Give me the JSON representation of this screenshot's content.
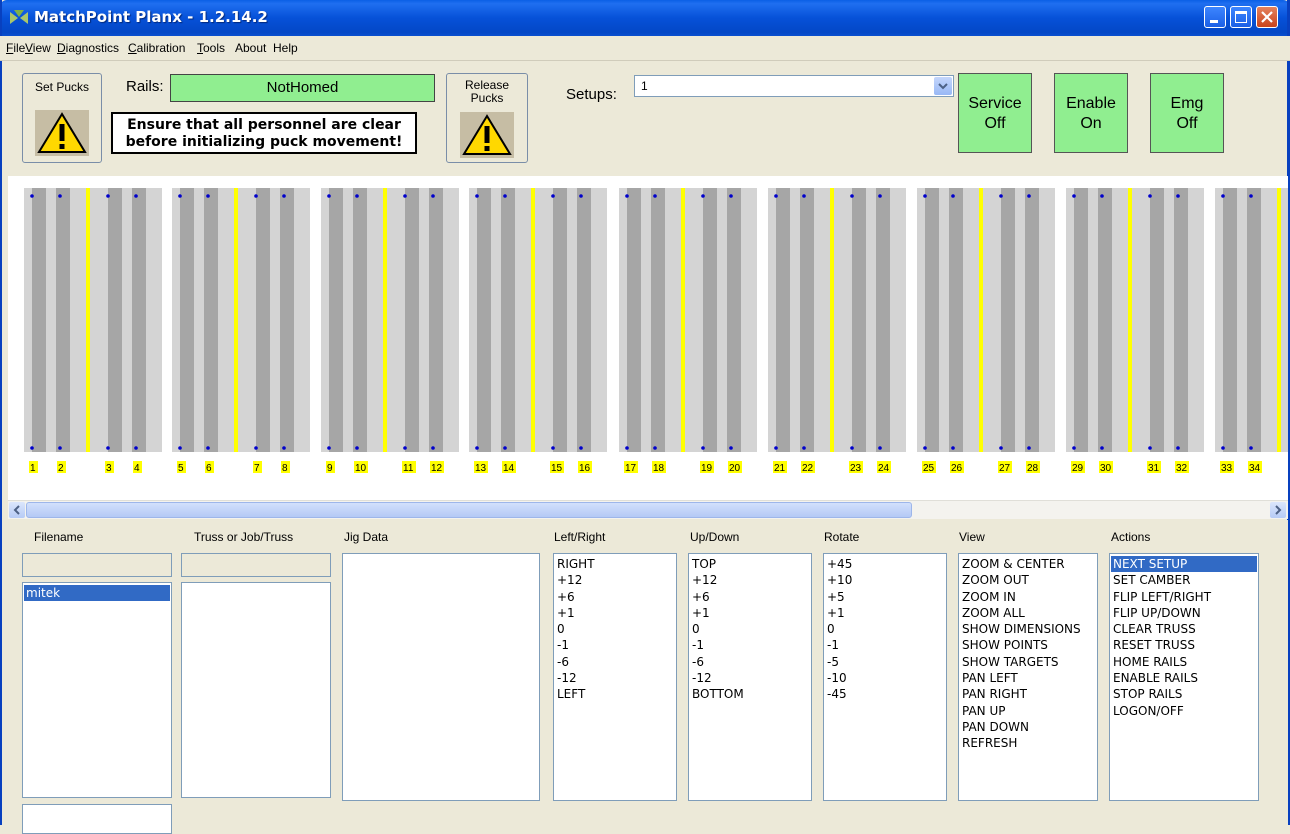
{
  "window": {
    "title": "MatchPoint Planx - 1.2.14.2"
  },
  "menu": [
    {
      "label": "File",
      "u": "F",
      "rest": "ile"
    },
    {
      "label": "View",
      "u": "V",
      "rest": "iew"
    },
    {
      "label": "Diagnostics",
      "u": "D",
      "rest": "iagnostics"
    },
    {
      "label": "Calibration",
      "u": "C",
      "rest": "alibration"
    },
    {
      "label": "Tools",
      "u": "T",
      "rest": "ools"
    },
    {
      "label": "About",
      "u": "",
      "rest": "About"
    },
    {
      "label": "Help",
      "u": "",
      "rest": "Help"
    }
  ],
  "toolbar": {
    "set_pucks": "Set Pucks",
    "rails_label": "Rails:",
    "rails_status": "NotHomed",
    "warning_line1": "Ensure that all personnel are clear",
    "warning_line2": "before initializing puck movement!",
    "release_line1": "Release",
    "release_line2": "Pucks",
    "setups_label": "Setups:",
    "setups_value": "1",
    "service_line1": "Service",
    "service_line2": "Off",
    "enable_line1": "Enable",
    "enable_line2": "On",
    "emg_line1": "Emg",
    "emg_line2": "Off"
  },
  "rails": {
    "labels": [
      "1",
      "2",
      "3",
      "4",
      "5",
      "6",
      "7",
      "8",
      "9",
      "10",
      "11",
      "12",
      "13",
      "14",
      "15",
      "16",
      "17",
      "18",
      "19",
      "20",
      "21",
      "22",
      "23",
      "24",
      "25",
      "26",
      "27",
      "28",
      "29",
      "30",
      "31",
      "32",
      "33",
      "34"
    ],
    "colors": {
      "light": "#d4d4d4",
      "dark": "#a6a6a6",
      "yellow": "#ffff00",
      "puck": "#0000cc"
    }
  },
  "columns": {
    "filename": "Filename",
    "truss": "Truss or Job/Truss",
    "jig": "Jig Data",
    "leftright": "Left/Right",
    "updown": "Up/Down",
    "rotate": "Rotate",
    "view": "View",
    "actions": "Actions"
  },
  "filename_list": [
    "mitek"
  ],
  "leftright_list": [
    "RIGHT",
    "+12",
    "+6",
    "+1",
    "0",
    "-1",
    "-6",
    "-12",
    "LEFT"
  ],
  "updown_list": [
    "TOP",
    "+12",
    "+6",
    "+1",
    "0",
    "-1",
    "-6",
    "-12",
    "BOTTOM"
  ],
  "rotate_list": [
    "+45",
    "+10",
    "+5",
    "+1",
    "0",
    "-1",
    "-5",
    "-10",
    "-45"
  ],
  "view_list": [
    "ZOOM & CENTER",
    "ZOOM OUT",
    "ZOOM IN",
    "ZOOM ALL",
    "SHOW DIMENSIONS",
    "SHOW POINTS",
    "SHOW TARGETS",
    "PAN LEFT",
    "PAN RIGHT",
    "PAN UP",
    "PAN DOWN",
    "REFRESH"
  ],
  "actions_list": [
    "NEXT SETUP",
    "SET CAMBER",
    "FLIP LEFT/RIGHT",
    "FLIP UP/DOWN",
    "CLEAR TRUSS",
    "RESET TRUSS",
    "HOME RAILS",
    "ENABLE RAILS",
    "STOP RAILS",
    "LOGON/OFF"
  ],
  "actions_selected": "NEXT SETUP",
  "filename_selected": "mitek"
}
